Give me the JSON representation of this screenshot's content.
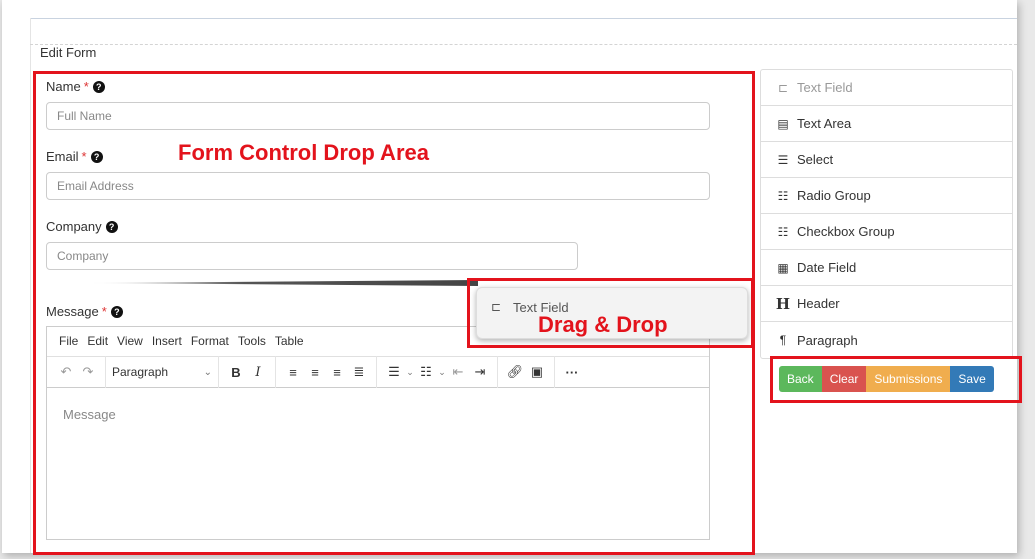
{
  "page_title": "Edit Form",
  "fields": {
    "name": {
      "label": "Name",
      "required": "*",
      "placeholder": "Full Name"
    },
    "email": {
      "label": "Email",
      "required": "*",
      "placeholder": "Email Address"
    },
    "company": {
      "label": "Company",
      "placeholder": "Company"
    },
    "message": {
      "label": "Message",
      "required": "*",
      "placeholder": "Message"
    }
  },
  "help_glyph": "?",
  "annotations": {
    "drop_area": "Form Control Drop Area",
    "drag_drop": "Drag & Drop"
  },
  "drag_ghost": {
    "label": "Text Field",
    "icon": "text-field-icon"
  },
  "editor": {
    "menus": [
      "File",
      "Edit",
      "View",
      "Insert",
      "Format",
      "Tools",
      "Table"
    ],
    "block_format": "Paragraph",
    "content_placeholder": "Message"
  },
  "palette": [
    {
      "label": "Text Field",
      "icon": "text-field-icon",
      "glyph": "⊏",
      "state": "dragging"
    },
    {
      "label": "Text Area",
      "icon": "text-area-icon",
      "glyph": "▤"
    },
    {
      "label": "Select",
      "icon": "select-icon",
      "glyph": "☰"
    },
    {
      "label": "Radio Group",
      "icon": "radio-group-icon",
      "glyph": "☷"
    },
    {
      "label": "Checkbox Group",
      "icon": "checkbox-group-icon",
      "glyph": "☷"
    },
    {
      "label": "Date Field",
      "icon": "calendar-icon",
      "glyph": "▦"
    },
    {
      "label": "Header",
      "icon": "header-icon",
      "glyph": "H"
    },
    {
      "label": "Paragraph",
      "icon": "paragraph-icon",
      "glyph": "¶"
    }
  ],
  "actions": {
    "back": "Back",
    "clear": "Clear",
    "submissions": "Submissions",
    "save": "Save"
  },
  "colors": {
    "annotation_red": "#e3131c",
    "back": "#5cb85c",
    "clear": "#d9534f",
    "submissions": "#f0ad4e",
    "save": "#337ab7"
  }
}
